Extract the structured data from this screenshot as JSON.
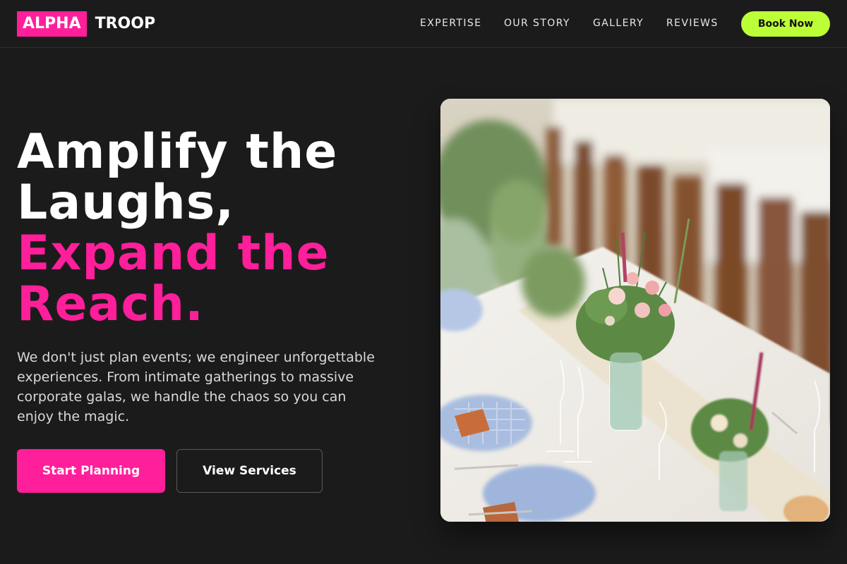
{
  "brand": {
    "logo_highlight": "ALPHA",
    "logo_word": "TROOP",
    "accent_color": "#ff1f9a",
    "cta_color": "#bdff37"
  },
  "nav": {
    "items": [
      {
        "label": "EXPERTISE"
      },
      {
        "label": "OUR STORY"
      },
      {
        "label": "GALLERY"
      },
      {
        "label": "REVIEWS"
      }
    ],
    "cta_label": "Book Now"
  },
  "hero": {
    "headline_line1": "Amplify the",
    "headline_line2": "Laughs,",
    "headline_line3": "Expand the",
    "headline_line4": "Reach.",
    "lead": "We don't just plan events; we engineer unforgettable experiences. From intimate gatherings to massive corporate galas, we handle the chaos so you can enjoy the magic.",
    "primary_button": "Start Planning",
    "secondary_button": "View Services"
  },
  "image": {
    "subject": "wedding banquet table with flower arrangements, glassware and blue gingham napkins"
  }
}
